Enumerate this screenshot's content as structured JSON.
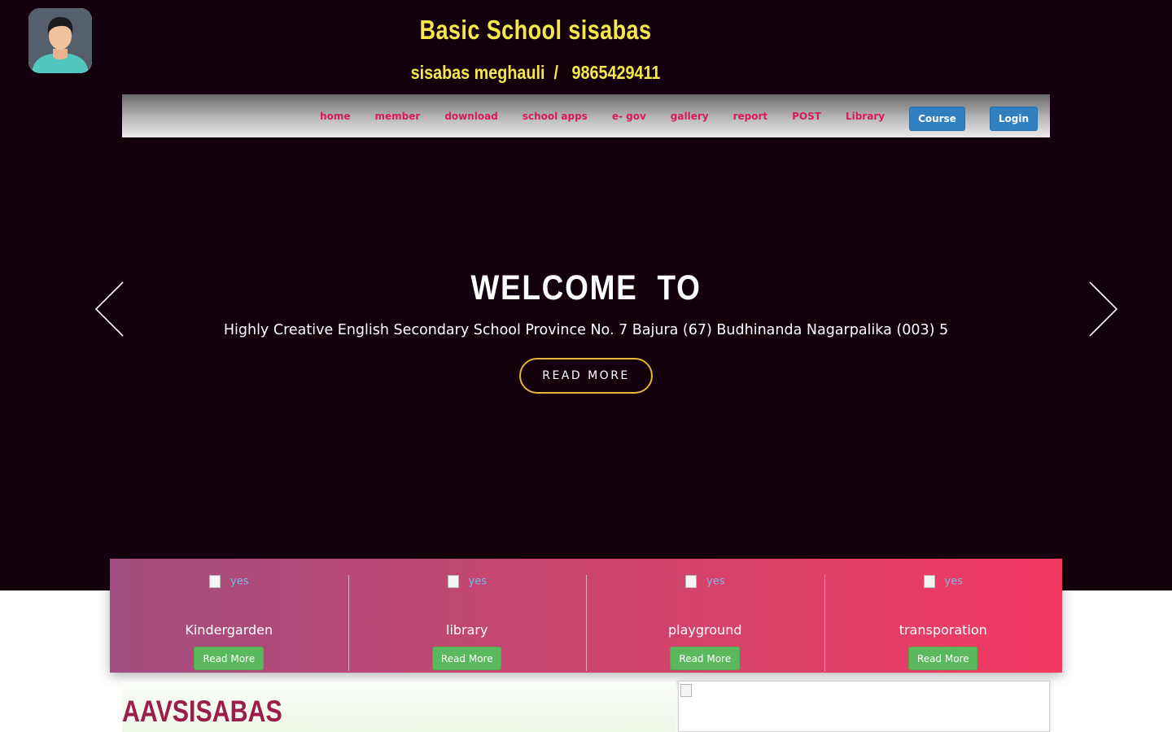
{
  "header": {
    "title": "Basic School sisabas",
    "subtitle": "sisabas meghauli  /   9865429411"
  },
  "nav": {
    "links": [
      "home",
      "member",
      "download",
      "school apps",
      "e- gov",
      "gallery",
      "report",
      "POST",
      "Library"
    ],
    "course_label": "Course",
    "login_label": "Login"
  },
  "hero": {
    "heading": "WELCOME  TO",
    "description": "Highly Creative English Secondary School Province No. 7 Bajura (67) Budhinanda Nagarpalika (003) 5",
    "button_label": "READ MORE"
  },
  "features": [
    {
      "img_alt": "yes",
      "title": "Kindergarden",
      "button": "Read More"
    },
    {
      "img_alt": "yes",
      "title": "library",
      "button": "Read More"
    },
    {
      "img_alt": "yes",
      "title": "playground",
      "button": "Read More"
    },
    {
      "img_alt": "yes",
      "title": "transporation",
      "button": "Read More"
    }
  ],
  "about": {
    "title": "AAVSISABAS"
  },
  "colors": {
    "hero_bg": "#14000d",
    "title_yellow": "#f5e84a",
    "nav_link": "#d81b5c",
    "button_blue": "#2f7fc1",
    "button_green": "#5cb85c",
    "about_title": "#9c1c4c"
  },
  "icons": [
    "user-avatar-icon",
    "chevron-left-icon",
    "chevron-right-icon",
    "broken-image-icon"
  ]
}
